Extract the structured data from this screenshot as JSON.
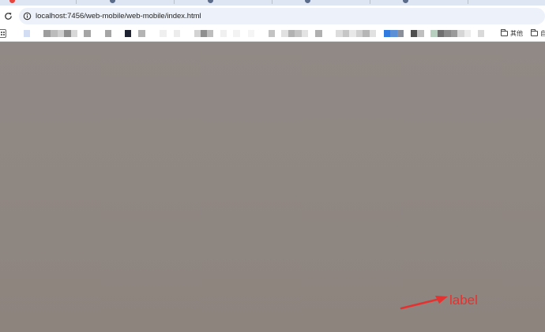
{
  "address_bar": {
    "url": "localhost:7456/web-mobile/web-mobile/index.html"
  },
  "bookmarks_bar": {
    "other_bookmarks_label": "其他",
    "trailing_folder_label": "自"
  },
  "annotation": {
    "text": "label",
    "color": "#e5312f"
  },
  "icons": {
    "reload": "reload-icon",
    "site_info": "site-info-icon",
    "apps": "apps-icon",
    "folder": "folder-icon",
    "arrow": "red-arrow-annotation"
  },
  "colors": {
    "canvas": "#8f8782",
    "omnibox": "#edf2fa",
    "tabstrip": "#dfe6f3"
  }
}
